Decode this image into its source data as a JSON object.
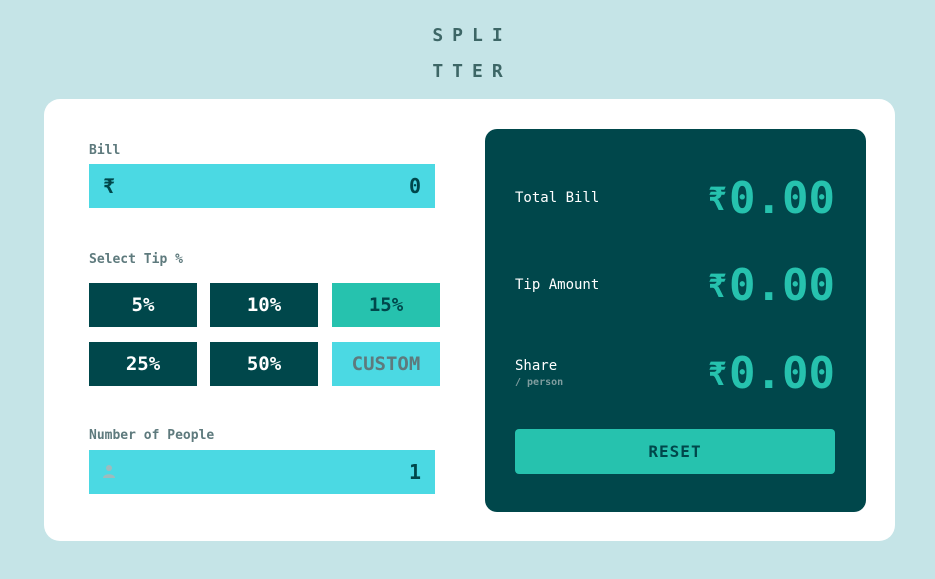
{
  "app": {
    "logo_line1": "SPLI",
    "logo_line2": "TTER"
  },
  "bill": {
    "label": "Bill",
    "currency_icon": "₹",
    "value": "0"
  },
  "tip": {
    "label": "Select Tip %",
    "options": [
      "5%",
      "10%",
      "15%",
      "25%",
      "50%"
    ],
    "selected": "15%",
    "custom_placeholder": "CUSTOM"
  },
  "people": {
    "label": "Number of People",
    "icon": "person-icon",
    "value": "1"
  },
  "results": {
    "total_label": "Total Bill",
    "total_value": "0.00",
    "tip_label": "Tip Amount",
    "tip_value": "0.00",
    "share_label": "Share",
    "share_sub": "/ person",
    "share_value": "0.00",
    "currency": "₹",
    "reset_label": "RESET"
  },
  "colors": {
    "background": "#c5e4e7",
    "dark_teal": "#00474b",
    "accent": "#26c2ae",
    "input_bg": "#4bd9e3"
  }
}
